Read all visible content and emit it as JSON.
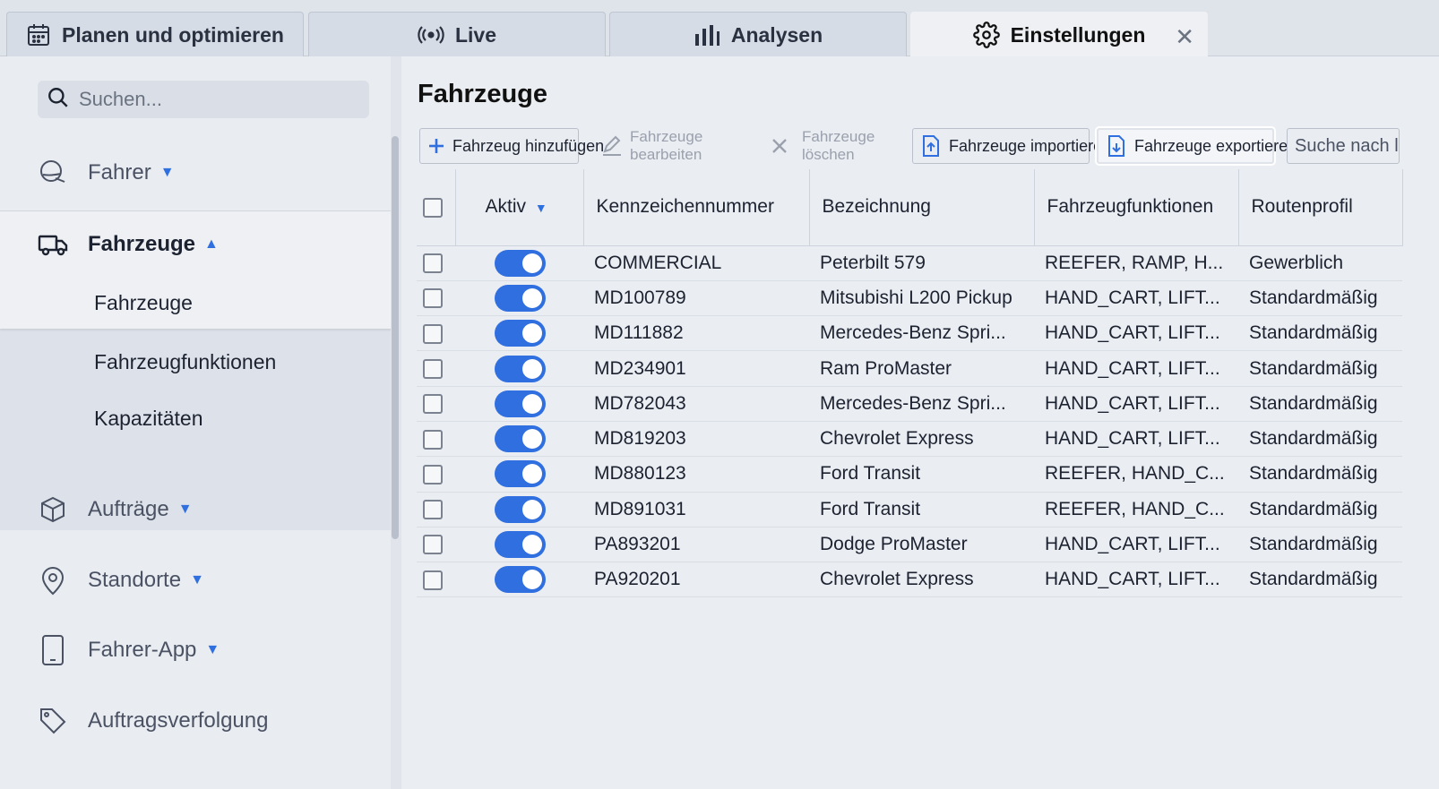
{
  "tabs": [
    {
      "label": "Planen und optimieren",
      "icon": "calendar-icon"
    },
    {
      "label": "Live",
      "icon": "broadcast-icon"
    },
    {
      "label": "Analysen",
      "icon": "bar-chart-icon"
    },
    {
      "label": "Einstellungen",
      "icon": "gear-icon",
      "active": true,
      "close": "✕"
    }
  ],
  "sidebar": {
    "search_placeholder": "Suchen...",
    "items": [
      {
        "label": "Fahrer",
        "icon": "driver-icon"
      },
      {
        "label": "Fahrzeuge",
        "icon": "truck-icon",
        "expanded": true
      },
      {
        "label": "Aufträge",
        "icon": "package-icon"
      },
      {
        "label": "Standorte",
        "icon": "location-pin-icon"
      },
      {
        "label": "Fahrer-App",
        "icon": "phone-icon"
      },
      {
        "label": "Auftragsverfolgung",
        "icon": "tag-icon"
      }
    ],
    "sub_items": [
      "Fahrzeuge",
      "Fahrzeugfunktionen",
      "Kapazitäten"
    ]
  },
  "main": {
    "title": "Fahrzeuge",
    "toolbar": {
      "add": "Fahrzeug hinzufügen",
      "edit": "Fahrzeuge bearbeiten",
      "delete": "Fahrzeuge löschen",
      "import": "Fahrzeuge importieren",
      "export": "Fahrzeuge exportieren",
      "search": "Suche nach li"
    },
    "columns": [
      "Aktiv",
      "Kennzeichennummer",
      "Bezeichnung",
      "Fahrzeugfunktionen",
      "Routenprofil"
    ],
    "rows": [
      {
        "plate": "COMMERCIAL",
        "name": "Peterbilt 579",
        "features": "REEFER, RAMP, H...",
        "profile": "Gewerblich",
        "active": true
      },
      {
        "plate": "MD100789",
        "name": "Mitsubishi L200 Pickup",
        "features": "HAND_CART, LIFT...",
        "profile": "Standardmäßig",
        "active": true
      },
      {
        "plate": "MD111882",
        "name": "Mercedes-Benz Spri...",
        "features": "HAND_CART, LIFT...",
        "profile": "Standardmäßig",
        "active": true
      },
      {
        "plate": "MD234901",
        "name": "Ram ProMaster",
        "features": "HAND_CART, LIFT...",
        "profile": "Standardmäßig",
        "active": true
      },
      {
        "plate": "MD782043",
        "name": "Mercedes-Benz Spri...",
        "features": "HAND_CART, LIFT...",
        "profile": "Standardmäßig",
        "active": true
      },
      {
        "plate": "MD819203",
        "name": "Chevrolet Express",
        "features": "HAND_CART, LIFT...",
        "profile": "Standardmäßig",
        "active": true
      },
      {
        "plate": "MD880123",
        "name": "Ford Transit",
        "features": "REEFER, HAND_C...",
        "profile": "Standardmäßig",
        "active": true
      },
      {
        "plate": "MD891031",
        "name": "Ford Transit",
        "features": "REEFER, HAND_C...",
        "profile": "Standardmäßig",
        "active": true
      },
      {
        "plate": "PA893201",
        "name": "Dodge ProMaster",
        "features": "HAND_CART, LIFT...",
        "profile": "Standardmäßig",
        "active": true
      },
      {
        "plate": "PA920201",
        "name": "Chevrolet Express",
        "features": "HAND_CART, LIFT...",
        "profile": "Standardmäßig",
        "active": true
      }
    ]
  },
  "colors": {
    "accent": "#2f6fe0"
  }
}
